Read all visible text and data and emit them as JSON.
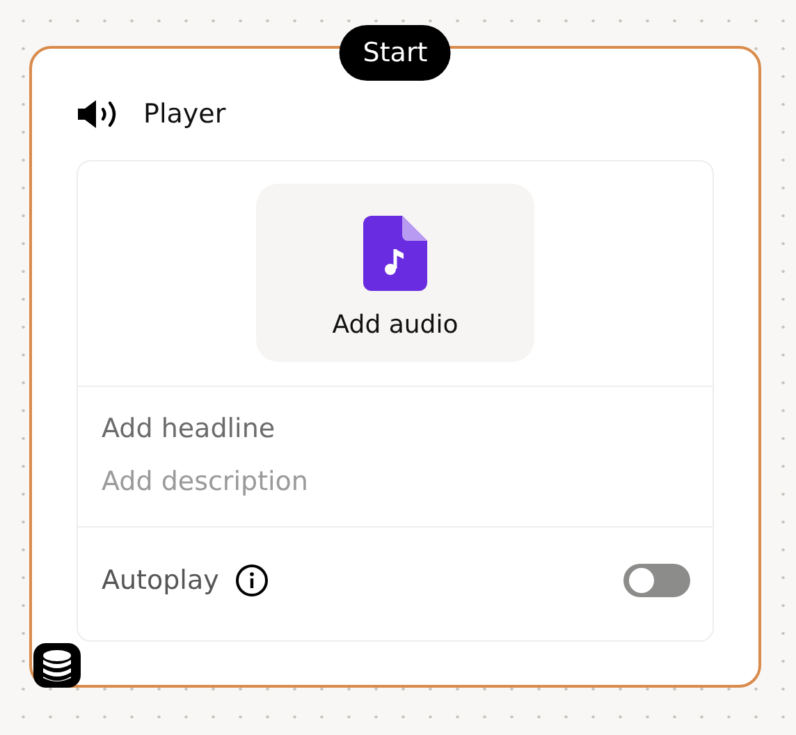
{
  "badge": {
    "label": "Start"
  },
  "header": {
    "title": "Player"
  },
  "media": {
    "label": "Add audio"
  },
  "headline": {
    "placeholder": "Add headline"
  },
  "description": {
    "placeholder": "Add description"
  },
  "autoplay": {
    "label": "Autoplay",
    "on": false
  }
}
